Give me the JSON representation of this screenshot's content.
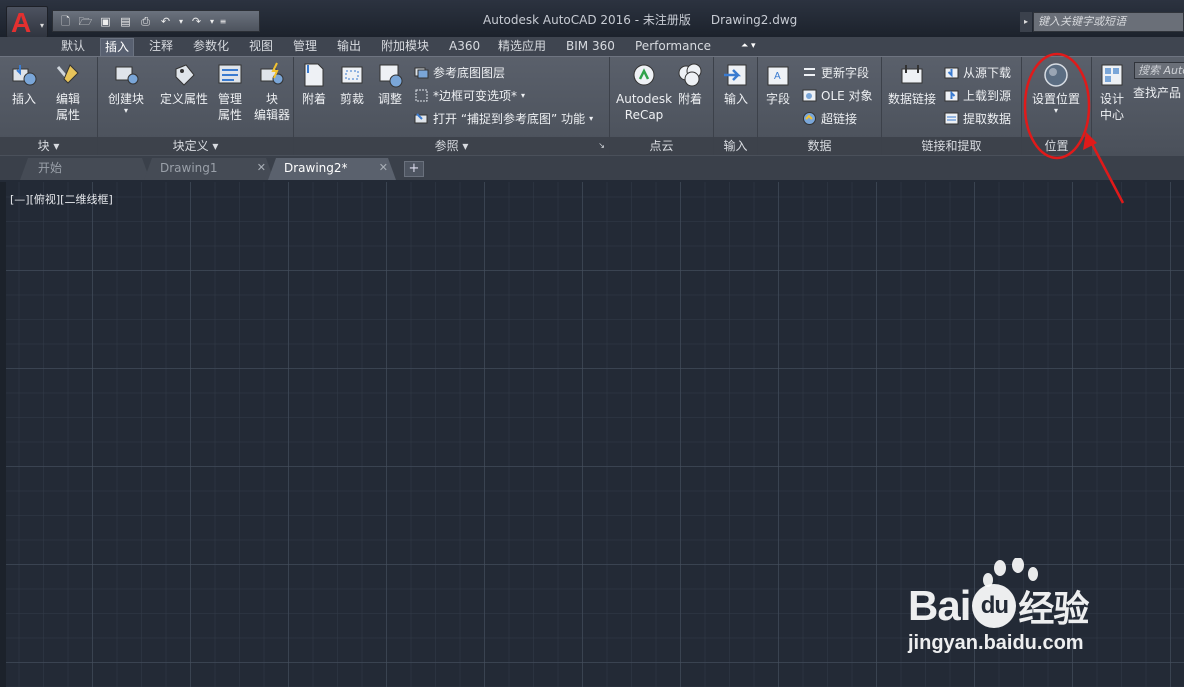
{
  "title_bar": {
    "app_title": "Autodesk AutoCAD 2016 - 未注册版",
    "document": "Drawing2.dwg",
    "search_placeholder": "键入关键字或短语"
  },
  "ribbon_tabs": [
    "默认",
    "插入",
    "注释",
    "参数化",
    "视图",
    "管理",
    "输出",
    "附加模块",
    "A360",
    "精选应用",
    "BIM 360",
    "Performance"
  ],
  "active_tab": "插入",
  "panels": {
    "block": {
      "label": "块",
      "insert": "插入",
      "edit_attr_1": "编辑",
      "edit_attr_2": "属性"
    },
    "block_def": {
      "label": "块定义",
      "create": "创建块",
      "define_attr": "定义属性",
      "manage_1": "管理",
      "manage_2": "属性",
      "editor_1": "块",
      "editor_2": "编辑器"
    },
    "reference": {
      "label": "参照",
      "attach": "附着",
      "clip": "剪裁",
      "adjust": "调整",
      "underlay_layers": "参考底图图层",
      "frame_vary": "*边框可变选项*",
      "snap_text": "打开 “捕捉到参考底图” 功能"
    },
    "point_cloud": {
      "label": "点云",
      "recap_1": "Autodesk",
      "recap_2": "ReCap",
      "attach": "附着"
    },
    "import": {
      "label": "输入",
      "import": "输入"
    },
    "data": {
      "label": "数据",
      "field": "字段",
      "update_fields": "更新字段",
      "ole": "OLE 对象",
      "hyperlink": "超链接"
    },
    "linking": {
      "label": "链接和提取",
      "data_link": "数据链接",
      "download": "从源下载",
      "upload": "上载到源",
      "extract": "提取数据"
    },
    "location": {
      "label": "位置",
      "set_location": "设置位置"
    },
    "content": {
      "design_center_1": "设计",
      "design_center_2": "中心",
      "search_products": "查找产品",
      "search_placeholder": "搜索 Auto"
    }
  },
  "doc_tabs": [
    {
      "label": "开始"
    },
    {
      "label": "Drawing1"
    },
    {
      "label": "Drawing2*"
    }
  ],
  "viewport_label": "[—][俯视][二维线框]",
  "watermark": {
    "brand_left": "Bai",
    "brand_mid": "du",
    "brand_right": "经验",
    "url": "jingyan.baidu.com"
  },
  "colors": {
    "canvas": "#232a36",
    "ribbon": "#535964",
    "annotation": "#e01a1a",
    "logo": "#e33030"
  }
}
